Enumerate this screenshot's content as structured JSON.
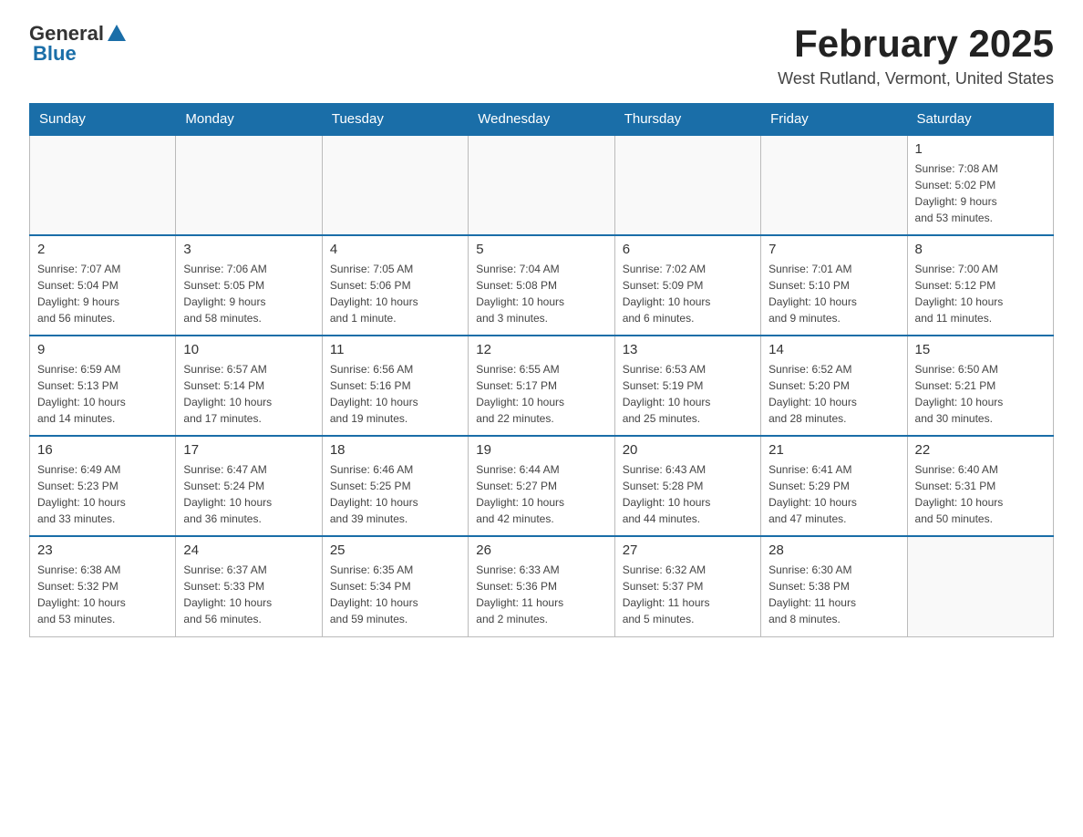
{
  "header": {
    "logo_general": "General",
    "logo_blue": "Blue",
    "month_title": "February 2025",
    "location": "West Rutland, Vermont, United States"
  },
  "days_of_week": [
    "Sunday",
    "Monday",
    "Tuesday",
    "Wednesday",
    "Thursday",
    "Friday",
    "Saturday"
  ],
  "weeks": [
    [
      {
        "day": "",
        "info": ""
      },
      {
        "day": "",
        "info": ""
      },
      {
        "day": "",
        "info": ""
      },
      {
        "day": "",
        "info": ""
      },
      {
        "day": "",
        "info": ""
      },
      {
        "day": "",
        "info": ""
      },
      {
        "day": "1",
        "info": "Sunrise: 7:08 AM\nSunset: 5:02 PM\nDaylight: 9 hours\nand 53 minutes."
      }
    ],
    [
      {
        "day": "2",
        "info": "Sunrise: 7:07 AM\nSunset: 5:04 PM\nDaylight: 9 hours\nand 56 minutes."
      },
      {
        "day": "3",
        "info": "Sunrise: 7:06 AM\nSunset: 5:05 PM\nDaylight: 9 hours\nand 58 minutes."
      },
      {
        "day": "4",
        "info": "Sunrise: 7:05 AM\nSunset: 5:06 PM\nDaylight: 10 hours\nand 1 minute."
      },
      {
        "day": "5",
        "info": "Sunrise: 7:04 AM\nSunset: 5:08 PM\nDaylight: 10 hours\nand 3 minutes."
      },
      {
        "day": "6",
        "info": "Sunrise: 7:02 AM\nSunset: 5:09 PM\nDaylight: 10 hours\nand 6 minutes."
      },
      {
        "day": "7",
        "info": "Sunrise: 7:01 AM\nSunset: 5:10 PM\nDaylight: 10 hours\nand 9 minutes."
      },
      {
        "day": "8",
        "info": "Sunrise: 7:00 AM\nSunset: 5:12 PM\nDaylight: 10 hours\nand 11 minutes."
      }
    ],
    [
      {
        "day": "9",
        "info": "Sunrise: 6:59 AM\nSunset: 5:13 PM\nDaylight: 10 hours\nand 14 minutes."
      },
      {
        "day": "10",
        "info": "Sunrise: 6:57 AM\nSunset: 5:14 PM\nDaylight: 10 hours\nand 17 minutes."
      },
      {
        "day": "11",
        "info": "Sunrise: 6:56 AM\nSunset: 5:16 PM\nDaylight: 10 hours\nand 19 minutes."
      },
      {
        "day": "12",
        "info": "Sunrise: 6:55 AM\nSunset: 5:17 PM\nDaylight: 10 hours\nand 22 minutes."
      },
      {
        "day": "13",
        "info": "Sunrise: 6:53 AM\nSunset: 5:19 PM\nDaylight: 10 hours\nand 25 minutes."
      },
      {
        "day": "14",
        "info": "Sunrise: 6:52 AM\nSunset: 5:20 PM\nDaylight: 10 hours\nand 28 minutes."
      },
      {
        "day": "15",
        "info": "Sunrise: 6:50 AM\nSunset: 5:21 PM\nDaylight: 10 hours\nand 30 minutes."
      }
    ],
    [
      {
        "day": "16",
        "info": "Sunrise: 6:49 AM\nSunset: 5:23 PM\nDaylight: 10 hours\nand 33 minutes."
      },
      {
        "day": "17",
        "info": "Sunrise: 6:47 AM\nSunset: 5:24 PM\nDaylight: 10 hours\nand 36 minutes."
      },
      {
        "day": "18",
        "info": "Sunrise: 6:46 AM\nSunset: 5:25 PM\nDaylight: 10 hours\nand 39 minutes."
      },
      {
        "day": "19",
        "info": "Sunrise: 6:44 AM\nSunset: 5:27 PM\nDaylight: 10 hours\nand 42 minutes."
      },
      {
        "day": "20",
        "info": "Sunrise: 6:43 AM\nSunset: 5:28 PM\nDaylight: 10 hours\nand 44 minutes."
      },
      {
        "day": "21",
        "info": "Sunrise: 6:41 AM\nSunset: 5:29 PM\nDaylight: 10 hours\nand 47 minutes."
      },
      {
        "day": "22",
        "info": "Sunrise: 6:40 AM\nSunset: 5:31 PM\nDaylight: 10 hours\nand 50 minutes."
      }
    ],
    [
      {
        "day": "23",
        "info": "Sunrise: 6:38 AM\nSunset: 5:32 PM\nDaylight: 10 hours\nand 53 minutes."
      },
      {
        "day": "24",
        "info": "Sunrise: 6:37 AM\nSunset: 5:33 PM\nDaylight: 10 hours\nand 56 minutes."
      },
      {
        "day": "25",
        "info": "Sunrise: 6:35 AM\nSunset: 5:34 PM\nDaylight: 10 hours\nand 59 minutes."
      },
      {
        "day": "26",
        "info": "Sunrise: 6:33 AM\nSunset: 5:36 PM\nDaylight: 11 hours\nand 2 minutes."
      },
      {
        "day": "27",
        "info": "Sunrise: 6:32 AM\nSunset: 5:37 PM\nDaylight: 11 hours\nand 5 minutes."
      },
      {
        "day": "28",
        "info": "Sunrise: 6:30 AM\nSunset: 5:38 PM\nDaylight: 11 hours\nand 8 minutes."
      },
      {
        "day": "",
        "info": ""
      }
    ]
  ]
}
